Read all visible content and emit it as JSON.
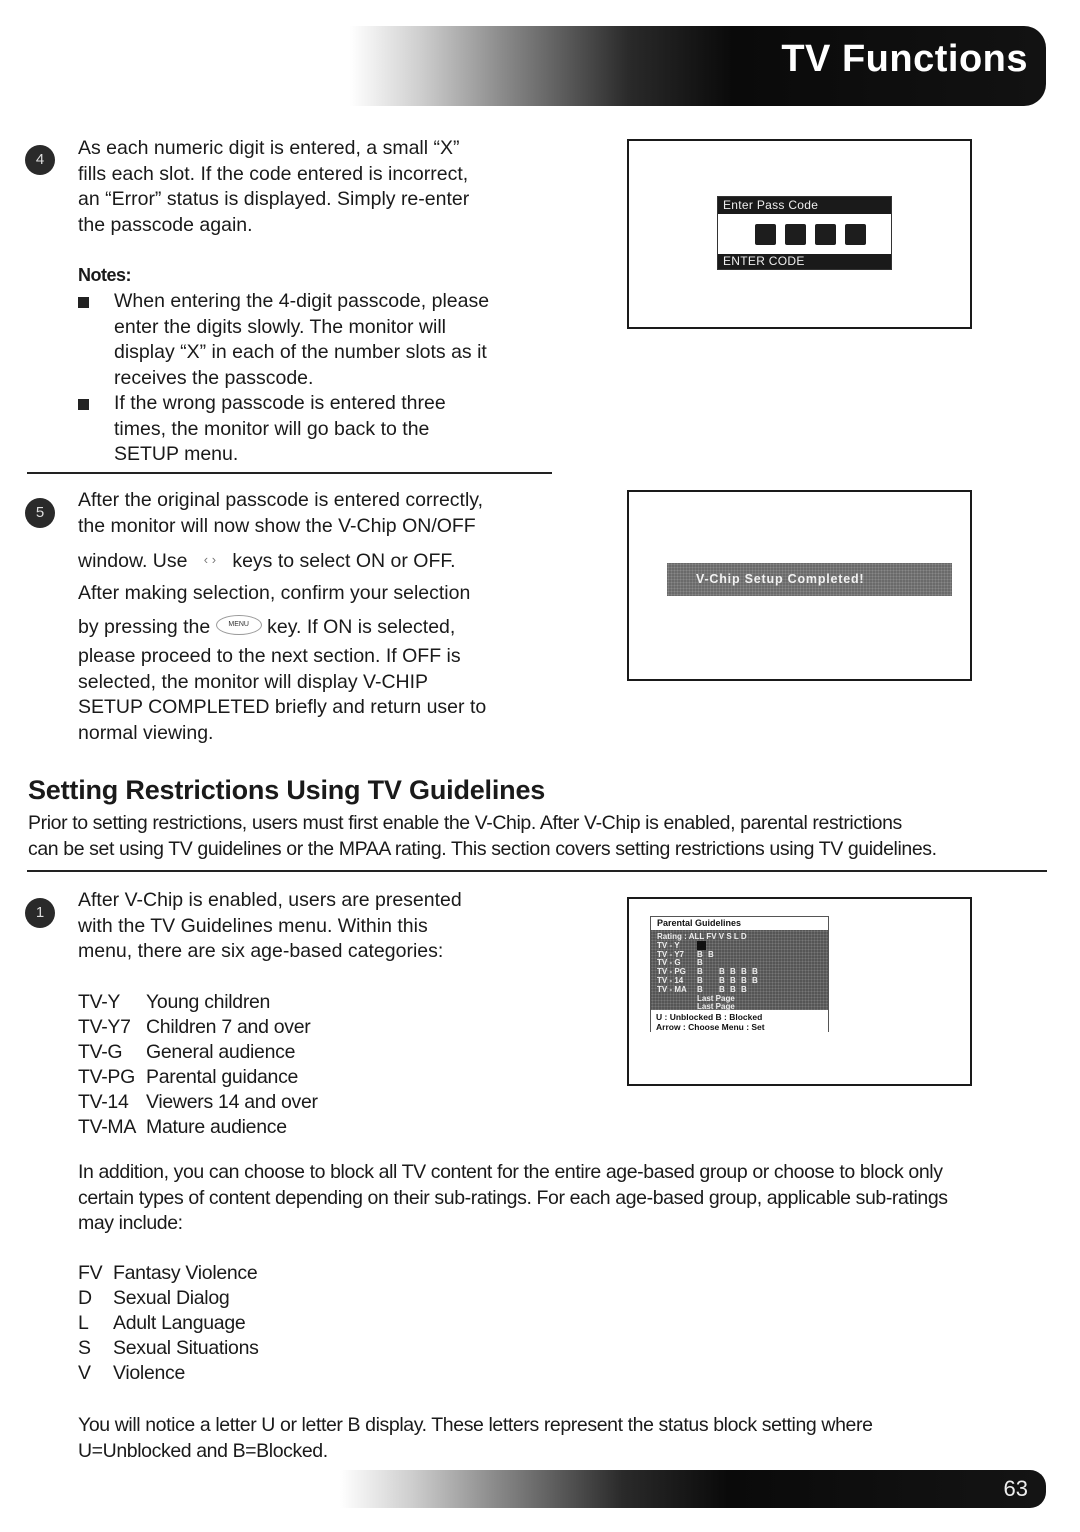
{
  "header": {
    "title": "TV Functions"
  },
  "footer": {
    "page_number": "63"
  },
  "step4": {
    "badge": "4",
    "lines": [
      "As each numeric digit is entered, a small “X”",
      "fills each slot.  If the code entered is incorrect,",
      "an “Error” status is displayed.  Simply re-enter",
      "the passcode again."
    ],
    "notes_title": "Notes:",
    "notes": [
      [
        "When entering the 4-digit passcode, please",
        "enter the digits slowly.  The monitor will",
        "display “X” in each of the number slots as it",
        "receives the passcode."
      ],
      [
        "If the wrong passcode is entered three",
        "times, the monitor will go back to the",
        "SETUP menu."
      ]
    ],
    "screen": {
      "title": "Enter Pass Code",
      "slots": 4,
      "footer": "ENTER CODE"
    }
  },
  "step5": {
    "badge": "5",
    "line1": "After the original passcode is entered correctly,",
    "line2": "the monitor will now show the V-Chip ON/OFF",
    "line3_pre": "window.  Use",
    "line3_post": "keys to select ON or OFF.",
    "lr_key_icon": "left-right-arrow-keys",
    "line4": "After making selection, confirm your selection",
    "line5_pre": "by pressing the",
    "menu_key_label": "MENU",
    "line5_post": "key.  If ON is selected,",
    "rest": [
      "please proceed to the next section.  If OFF is",
      "selected, the monitor will display V-CHIP",
      "SETUP COMPLETED briefly and return user to",
      "normal viewing."
    ],
    "screen": {
      "message": "V-Chip Setup Completed!"
    }
  },
  "section": {
    "title": "Setting Restrictions Using TV Guidelines",
    "intro": [
      "Prior to setting restrictions, users must first enable the V-Chip.  After V-Chip is enabled, parental restrictions",
      "can be set using TV guidelines or the MPAA rating.  This section covers setting restrictions using TV guidelines."
    ]
  },
  "step1": {
    "badge": "1",
    "lines": [
      "After V-Chip is enabled, users are presented",
      "with the TV Guidelines menu.  Within this",
      "menu, there are six age-based categories:"
    ],
    "categories": [
      {
        "code": "TV-Y",
        "desc": "Young children"
      },
      {
        "code": "TV-Y7",
        "desc": "Children 7 and over"
      },
      {
        "code": "TV-G",
        "desc": "General audience"
      },
      {
        "code": "TV-PG",
        "desc": "Parental guidance"
      },
      {
        "code": "TV-14",
        "desc": "Viewers 14 and over"
      },
      {
        "code": "TV-MA",
        "desc": "Mature audience"
      }
    ],
    "screen": {
      "title": "Parental Guidelines",
      "header_row": "Rating : ALL  FV  V  S  L  D",
      "rows": [
        {
          "label": "TV - Y",
          "cells": [
            "U",
            "",
            "",
            "",
            "",
            ""
          ]
        },
        {
          "label": "TV - Y7",
          "cells": [
            "B",
            "",
            "",
            "",
            "",
            ""
          ],
          "extra": "B"
        },
        {
          "label": "TV - G",
          "cells": [
            "B",
            "",
            "",
            "",
            "",
            ""
          ]
        },
        {
          "label": "TV - PG",
          "cells": [
            "B",
            "",
            "B",
            "B",
            "B",
            "B"
          ]
        },
        {
          "label": "TV - 14",
          "cells": [
            "B",
            "",
            "B",
            "B",
            "B",
            "B"
          ]
        },
        {
          "label": "TV - MA",
          "cells": [
            "B",
            "",
            "B",
            "B",
            "B",
            ""
          ]
        }
      ],
      "links": [
        "Last Page",
        "Last Page"
      ],
      "legend": "U : Unblocked  B : Blocked",
      "controls": "Arrow : Choose    Menu : Set"
    }
  },
  "addition": {
    "lines": [
      "In addition, you can choose to block all TV content for the entire age-based group or choose to block only",
      "certain types of content depending on their sub-ratings.  For each age-based group, applicable sub-ratings",
      "may include:"
    ],
    "sub_ratings": [
      {
        "code": "FV",
        "desc": "Fantasy Violence"
      },
      {
        "code": "D",
        "desc": "Sexual Dialog"
      },
      {
        "code": "L",
        "desc": "Adult Language"
      },
      {
        "code": "S",
        "desc": "Sexual Situations"
      },
      {
        "code": "V",
        "desc": "Violence"
      }
    ]
  },
  "closing": {
    "lines": [
      "You will notice a letter U or letter B display.  These letters represent the status block setting where",
      "U=Unblocked and B=Blocked."
    ]
  }
}
